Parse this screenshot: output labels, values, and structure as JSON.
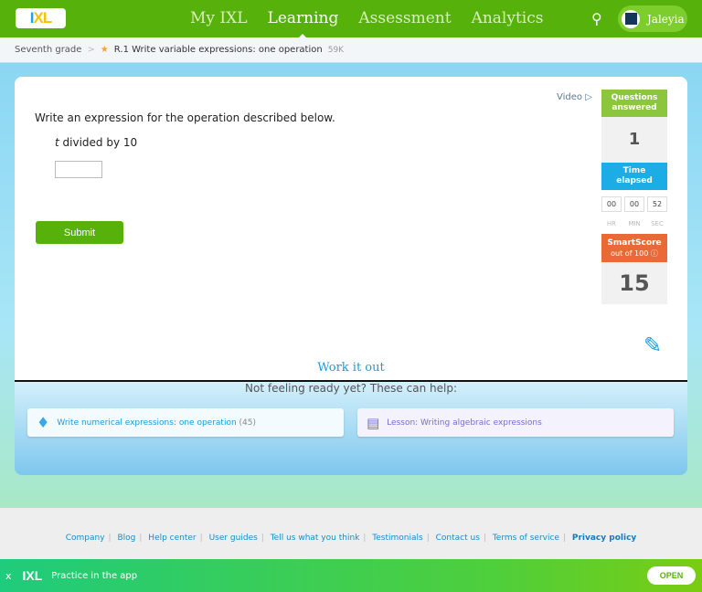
{
  "header": {
    "logo": "IXL",
    "nav": [
      "My IXL",
      "Learning",
      "Assessment",
      "Analytics"
    ],
    "active": "Learning",
    "user": "Jaleyia"
  },
  "breadcrumb": {
    "grade": "Seventh grade",
    "skill": "R.1 Write variable expressions: one operation",
    "count": "59K"
  },
  "question": {
    "prompt": "Write an expression for the operation described below.",
    "var": "t",
    "expr": " divided by 10",
    "answer": "",
    "submit": "Submit",
    "video": "Video"
  },
  "sidebar": {
    "qa_label1": "Questions",
    "qa_label2": "answered",
    "qa_value": "1",
    "te_label1": "Time",
    "te_label2": "elapsed",
    "hr": "00",
    "min": "00",
    "sec": "52",
    "hr_l": "HR",
    "min_l": "MIN",
    "sec_l": "SEC",
    "ss_label": "SmartScore",
    "ss_sub": "out of 100",
    "ss_value": "15"
  },
  "work": "Work it out",
  "help": {
    "title": "Not feeling ready yet? These can help:",
    "skill": "Write numerical expressions: one operation",
    "skill_count": "(45)",
    "lesson": "Lesson: Writing algebraic expressions"
  },
  "footer": {
    "links": [
      "Company",
      "Blog",
      "Help center",
      "User guides",
      "Tell us what you think",
      "Testimonials",
      "Contact us",
      "Terms of service"
    ],
    "privacy": "Privacy policy"
  },
  "banner": {
    "close": "x",
    "logo": "IXL",
    "text": "Practice in the app",
    "open": "OPEN"
  }
}
